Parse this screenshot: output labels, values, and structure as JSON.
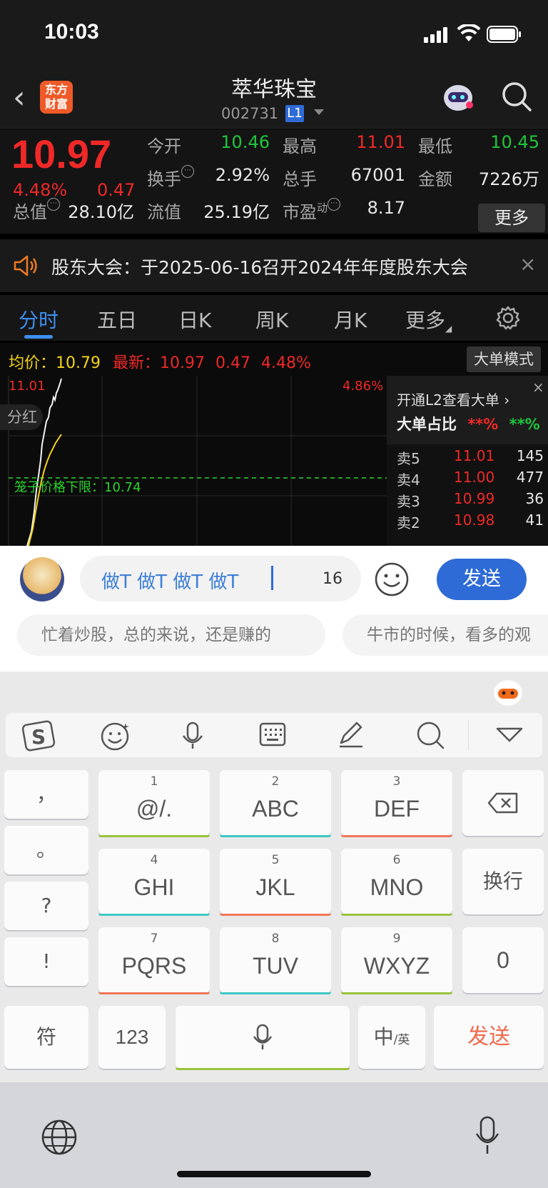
{
  "status": {
    "time": "10:03"
  },
  "header": {
    "back_glyph": "‹",
    "logo_line1": "东方",
    "logo_line2": "财富",
    "name": "萃华珠宝",
    "code": "002731",
    "level_badge": "L1"
  },
  "quote": {
    "price": "10.97",
    "change_pct": "4.48%",
    "change": "0.47",
    "open_label": "今开",
    "open": "10.46",
    "high_label": "最高",
    "high": "11.01",
    "low_label": "最低",
    "low": "10.45",
    "turnover_label": "换手",
    "turnover": "2.92%",
    "volume_label": "总手",
    "volume": "67001",
    "amount_label": "金额",
    "amount": "7226万",
    "mktcap_label": "总值",
    "mktcap": "28.10亿",
    "float_label": "流值",
    "float": "25.19亿",
    "pe_label": "市盈",
    "pe_sup": "动",
    "pe": "8.17",
    "more_label": "更多"
  },
  "notice": {
    "text": "股东大会：于2025-06-16召开2024年年度股东大会",
    "close": "×"
  },
  "tabs": [
    {
      "label": "分时"
    },
    {
      "label": "五日"
    },
    {
      "label": "日K"
    },
    {
      "label": "周K"
    },
    {
      "label": "月K"
    },
    {
      "label": "更多"
    }
  ],
  "chart_head": {
    "avg_label": "均价：",
    "avg": "10.79",
    "latest_label": "最新：",
    "latest": "10.97",
    "latest_chg": "0.47",
    "latest_pct": "4.48%",
    "mode_btn": "大单模式"
  },
  "chart": {
    "high": "11.01",
    "high_pct": "4.86%",
    "dividend_tag": "分红",
    "limit_label": "笼子价格下限：10.74"
  },
  "book": {
    "l2_link": "开通L2查看大单 ›",
    "ratio_label": "大单占比",
    "ratio_sell": "**%",
    "ratio_buy": "**%",
    "close": "×",
    "rows": [
      {
        "side": "卖5",
        "price": "11.01",
        "vol": "145"
      },
      {
        "side": "卖4",
        "price": "11.00",
        "vol": "477"
      },
      {
        "side": "卖3",
        "price": "10.99",
        "vol": "36"
      },
      {
        "side": "卖2",
        "price": "10.98",
        "vol": "41"
      }
    ]
  },
  "comment": {
    "input_text": "做T 做T 做T 做T",
    "char_count": "16",
    "send_label": "发送",
    "suggestions": [
      "忙着炒股，总的来说，还是赚的",
      "牛市的时候，看多的观"
    ]
  },
  "keyboard": {
    "side_keys": [
      "，",
      "。",
      "?",
      "!"
    ],
    "keys": [
      {
        "num": "1",
        "label": "@/."
      },
      {
        "num": "2",
        "label": "ABC"
      },
      {
        "num": "3",
        "label": "DEF"
      },
      {
        "num": "4",
        "label": "GHI"
      },
      {
        "num": "5",
        "label": "JKL"
      },
      {
        "num": "6",
        "label": "MNO"
      },
      {
        "num": "7",
        "label": "PQRS"
      },
      {
        "num": "8",
        "label": "TUV"
      },
      {
        "num": "9",
        "label": "WXYZ"
      }
    ],
    "newline_label": "换行",
    "zero_label": "0",
    "symbol_label": "符",
    "numeric_label": "123",
    "lang_label": "中",
    "lang_sub": "/英",
    "send_label": "发送"
  },
  "colors": {
    "up": "#f02828",
    "down": "#1fc63c",
    "accent": "#2f6bd6"
  }
}
